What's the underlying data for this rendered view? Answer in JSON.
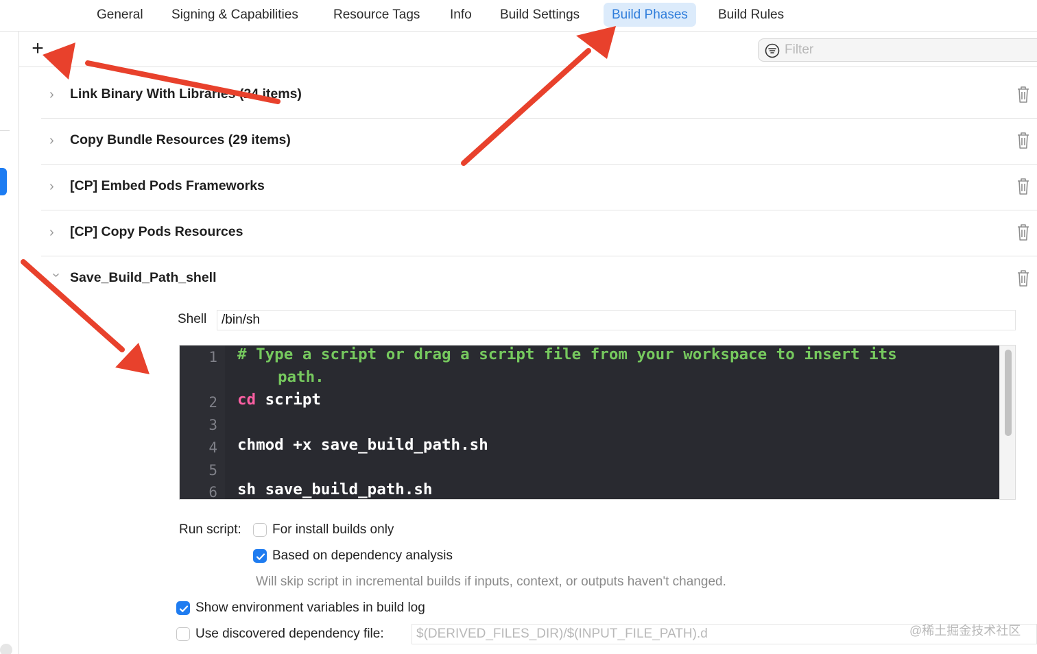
{
  "tabs": [
    {
      "label": "General",
      "active": false
    },
    {
      "label": "Signing & Capabilities",
      "active": false
    },
    {
      "label": "Resource Tags",
      "active": false
    },
    {
      "label": "Info",
      "active": false
    },
    {
      "label": "Build Settings",
      "active": false
    },
    {
      "label": "Build Phases",
      "active": true
    },
    {
      "label": "Build Rules",
      "active": false
    }
  ],
  "toolbar": {
    "add_label": "+",
    "filter_placeholder": "Filter"
  },
  "phases": [
    {
      "title": "Link Binary With Libraries (24 items)",
      "expanded": false
    },
    {
      "title": "Copy Bundle Resources (29 items)",
      "expanded": false
    },
    {
      "title": "[CP] Embed Pods Frameworks",
      "expanded": false
    },
    {
      "title": "[CP] Copy Pods Resources",
      "expanded": false
    },
    {
      "title": "Save_Build_Path_shell",
      "expanded": true
    }
  ],
  "script": {
    "shell_label": "Shell",
    "shell_value": "/bin/sh",
    "lines": [
      {
        "num": "1",
        "text": "# Type a script or drag a script file from your workspace to insert its",
        "cont": "path.",
        "kind": "comment"
      },
      {
        "num": "2",
        "keyword": "cd",
        "text": " script",
        "kind": "code"
      },
      {
        "num": "3",
        "text": "",
        "kind": "code"
      },
      {
        "num": "4",
        "text": "chmod +x save_build_path.sh",
        "kind": "code"
      },
      {
        "num": "5",
        "text": "",
        "kind": "code"
      },
      {
        "num": "6",
        "text": "sh save_build_path.sh",
        "kind": "code"
      }
    ]
  },
  "options": {
    "run_script_label": "Run script:",
    "install_only": {
      "label": "For install builds only",
      "checked": false
    },
    "dependency_analysis": {
      "label": "Based on dependency analysis",
      "checked": true
    },
    "hint": "Will skip script in incremental builds if inputs, context, or outputs haven't changed.",
    "show_env": {
      "label": "Show environment variables in build log",
      "checked": true
    },
    "dep_file": {
      "label": "Use discovered dependency file:",
      "checked": false,
      "placeholder": "$(DERIVED_FILES_DIR)/$(INPUT_FILE_PATH).d"
    }
  },
  "watermark": "@稀土掘金技术社区",
  "colors": {
    "accent": "#1f7cf0",
    "annotation_arrow": "#e8412c",
    "editor_bg": "#292a30",
    "comment": "#76c95e",
    "keyword": "#fc5fa3"
  }
}
